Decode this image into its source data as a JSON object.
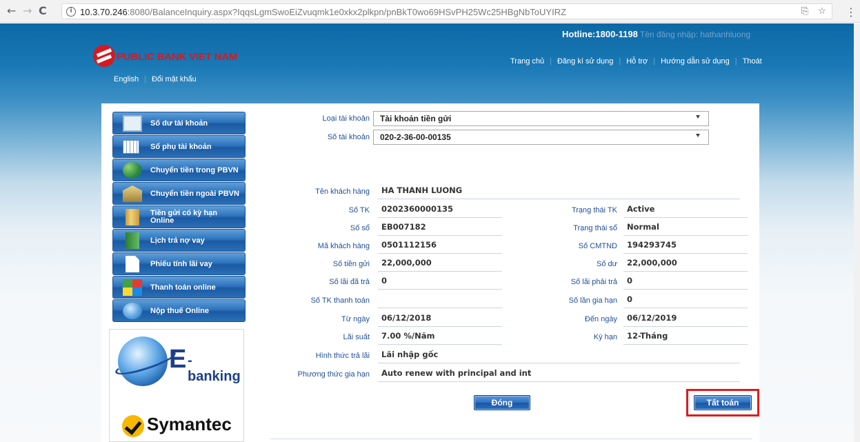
{
  "browser": {
    "url_host": "10.3.70.246",
    "url_rest": ":8080/BalanceInquiry.aspx?IqqsLgmSwoEiZvuqmk1e0xkx2plkpn/pnBkT0wo69HSvPH25Wc25HBgNbToUYIRZ",
    "back_icon": "←",
    "forward_icon": "→",
    "reload_icon": "C",
    "info_icon": "i",
    "star_icon": "☆",
    "menu_icon": "⋮"
  },
  "header": {
    "hotline": "Hotline:1800-1198",
    "login_label": "Tên đăng nhập: hathanhluong",
    "logo_text": "PUBLIC BANK VIET NAM",
    "lang_link": "English",
    "change_password": "Đổi mật khẩu",
    "nav": [
      "Trang chủ",
      "Đăng kí sử dụng",
      "Hỗ trợ",
      "Hướng dẫn sử dụng",
      "Thoát"
    ]
  },
  "sidebar": {
    "items": [
      {
        "label": "Số dư tài khoản",
        "icon": "monitor-icon"
      },
      {
        "label": "Sổ phụ tài khoản",
        "icon": "calendar-grid-icon"
      },
      {
        "label": "Chuyển tiền trong PBVN",
        "icon": "transfer-arrows-icon"
      },
      {
        "label": "Chuyển tiền ngoài PBVN",
        "icon": "bank-building-icon"
      },
      {
        "label": "Tiền gửi có kỳ hạn Online",
        "icon": "book-icon"
      },
      {
        "label": "Lịch trả nợ vay",
        "icon": "ledger-icon"
      },
      {
        "label": "Phiếu tính lãi vay",
        "icon": "document-icon"
      },
      {
        "label": "Thanh toán online",
        "icon": "blocks-icon"
      },
      {
        "label": "Nộp thuế Online",
        "icon": "globe-icon"
      }
    ]
  },
  "banners": {
    "ebanking_e": "E",
    "ebanking_rest": "-banking",
    "symantec": "Symantec"
  },
  "form": {
    "account_type_label": "Loại tài khoản",
    "account_type_value": "Tài khoản tiền gửi",
    "account_no_label": "Số tài khoản",
    "account_no_value": "020-2-36-00-00135",
    "customer_name_label": "Tên khách hàng",
    "customer_name_value": "HA THANH LUONG",
    "fields_left": [
      {
        "label": "Số TK",
        "value": "0202360000135"
      },
      {
        "label": "Số sổ",
        "value": "EB007182"
      },
      {
        "label": "Mã khách hàng",
        "value": "0501112156"
      },
      {
        "label": "Số tiền gửi",
        "value": "22,000,000"
      },
      {
        "label": "Số lãi đã trả",
        "value": "0"
      },
      {
        "label": "Số TK thanh toán",
        "value": ""
      },
      {
        "label": "Từ ngày",
        "value": "06/12/2018"
      },
      {
        "label": "Lãi suất",
        "value": "7.00 %/Năm"
      }
    ],
    "fields_right": [
      {
        "label": "Trạng thái TK",
        "value": "Active"
      },
      {
        "label": "Trạng thái sổ",
        "value": "Normal"
      },
      {
        "label": "Số CMTND",
        "value": "194293745"
      },
      {
        "label": "Số dư",
        "value": "22,000,000"
      },
      {
        "label": "Số lãi phải trả",
        "value": "0"
      },
      {
        "label": "Số lần gia hạn",
        "value": "0"
      },
      {
        "label": "Đến ngày",
        "value": "06/12/2019"
      },
      {
        "label": "Kỳ hạn",
        "value": "12-Tháng"
      }
    ],
    "payment_method_label": "Hình thức trả lãi",
    "payment_method_value": "Lãi nhập gốc",
    "renewal_label": "Phương thức gia hạn",
    "renewal_value": "Auto renew with principal and int",
    "close_button": "Đóng",
    "settle_button": "Tất toán"
  },
  "colors": {
    "header_blue": "#0d68a6",
    "label_blue": "#1f4e9a",
    "highlight_red": "#e01b1b",
    "logo_red": "#d71920"
  }
}
